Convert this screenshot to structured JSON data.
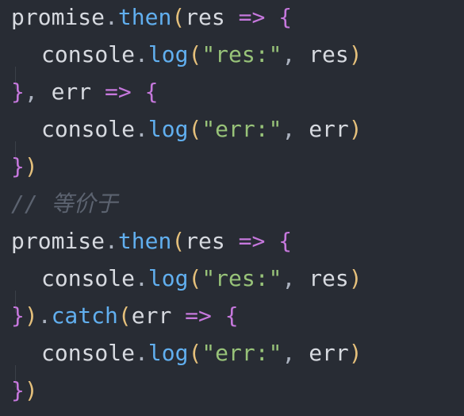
{
  "code": {
    "l1": {
      "obj": "promise",
      "dot": ".",
      "method": "then",
      "open": "(",
      "param": "res",
      "arrow": "=>",
      "brace": "{"
    },
    "l2": {
      "obj": "console",
      "dot": ".",
      "method": "log",
      "open": "(",
      "str": "\"res:\"",
      "comma": ",",
      "arg": "res",
      "close": ")"
    },
    "l3": {
      "brace": "}",
      "comma": ",",
      "param": "err",
      "arrow": "=>",
      "brace2": "{"
    },
    "l4": {
      "obj": "console",
      "dot": ".",
      "method": "log",
      "open": "(",
      "str": "\"err:\"",
      "comma": ",",
      "arg": "err",
      "close": ")"
    },
    "l5": {
      "brace": "}",
      "close": ")"
    },
    "l6": {
      "comment": "// 等价于"
    },
    "l7": {
      "obj": "promise",
      "dot": ".",
      "method": "then",
      "open": "(",
      "param": "res",
      "arrow": "=>",
      "brace": "{"
    },
    "l8": {
      "obj": "console",
      "dot": ".",
      "method": "log",
      "open": "(",
      "str": "\"res:\"",
      "comma": ",",
      "arg": "res",
      "close": ")"
    },
    "l9": {
      "brace": "}",
      "close": ")",
      "dot": ".",
      "method": "catch",
      "open": "(",
      "param": "err",
      "arrow": "=>",
      "brace2": "{"
    },
    "l10": {
      "obj": "console",
      "dot": ".",
      "method": "log",
      "open": "(",
      "str": "\"err:\"",
      "comma": ",",
      "arg": "err",
      "close": ")"
    },
    "l11": {
      "brace": "}",
      "close": ")"
    }
  },
  "colors": {
    "background": "#282c34",
    "identifier": "#d7dae0",
    "function": "#61afef",
    "paren": "#e5c07b",
    "brace": "#c678dd",
    "string": "#98c379",
    "comment": "#5c6370"
  }
}
